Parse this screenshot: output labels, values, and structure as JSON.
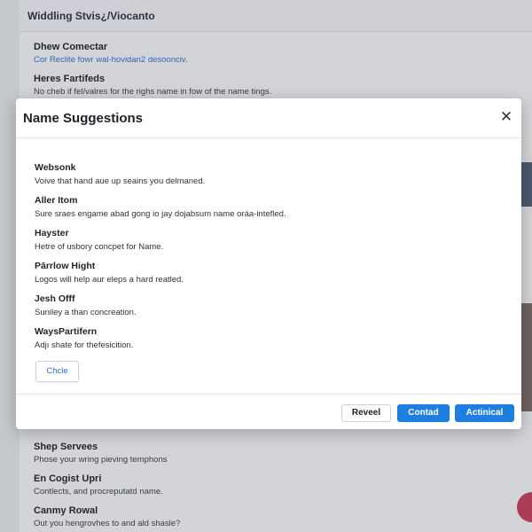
{
  "background": {
    "header_title": "Widdling Stvis¿/Viocanto",
    "top_items": [
      {
        "title": "Dhew Comectar",
        "desc": "Cor Reclite fowr wal-hovidan2 desoonciv."
      },
      {
        "title": "Heres Fartifeds",
        "desc": "No cheb if fel/valres for the righs name in fow of the name tings."
      }
    ],
    "bottom_items": [
      {
        "title": "Shep Servees",
        "desc": "Phose your wring pieving temphons"
      },
      {
        "title": "En Cogist Upri",
        "desc": "Contlects, and procreputatd name."
      },
      {
        "title": "Canmy Rowal",
        "desc": "Out you hengrovhes to and ald shasle?"
      }
    ]
  },
  "modal": {
    "title": "Name Suggestions",
    "close_icon": "close-icon",
    "suggestions": [
      {
        "title": "Websonk",
        "desc": "Voive that hand aue up seains you delmaned."
      },
      {
        "title": "Aller Itom",
        "desc": "Sure sraes engame abad gong io jay dojabsum name oráa-intefled."
      },
      {
        "title": "Hayster",
        "desc": "Hetre of usbory concpet for Name."
      },
      {
        "title": "Pārrlow Hight",
        "desc": "Logos will help aur eleps a hard reatled."
      },
      {
        "title": "Jesh Offf",
        "desc": "Suniley a than concreation."
      },
      {
        "title": "WaysPartifern",
        "desc": "Adjı shate for thefesicition."
      }
    ],
    "chip_label": "Chcle",
    "footer": {
      "secondary_label": "Reveel",
      "contact_label": "Contad",
      "action_label": "Actinical"
    }
  },
  "colors": {
    "primary": "#1f7fe0",
    "link": "#2f6fd0",
    "fab": "#c23b57"
  }
}
